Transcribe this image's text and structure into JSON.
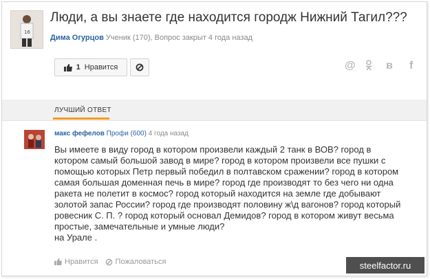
{
  "question": {
    "title": "Люди, а вы знаете где находится городж Нижний Тагил???",
    "author": "Дима Огурцов",
    "meta_rest": "Ученик (170), Вопрос закрыт 4 года назад",
    "like_count": "1",
    "like_label": "Нравится"
  },
  "share": {
    "mail": "@",
    "ok": "ok-icon",
    "vk": "в",
    "fb": "f"
  },
  "best_answer_label": "ЛУЧШИЙ ОТВЕТ",
  "answer": {
    "author": "макс фефелов",
    "rank": "Профи (600)",
    "time": "4 года назад",
    "text": "Вы имеете в виду город в котором произвели каждый 2 танк в ВОВ? город в\nкотором самый большой завод в мире? город в котором произвели все пушки с\nпомощью которых Петр первый победил в полтавском сражении? город в котором\nсамая большая доменная печь в мире? город где производят то без чего ни одна\nракета не полетит в космос? город который находится на земле где добывают\nзолотой запас России? город где производят половину ж\\д вагонов? город который\nровесник С. П. ? город который основал Демидов? город в котором живут весьма\nпростые, замечательные и умные люди?\nна Урале .",
    "like_label": "Нравится",
    "report_label": "Пожаловаться"
  },
  "watermark": "steelfactor.ru"
}
